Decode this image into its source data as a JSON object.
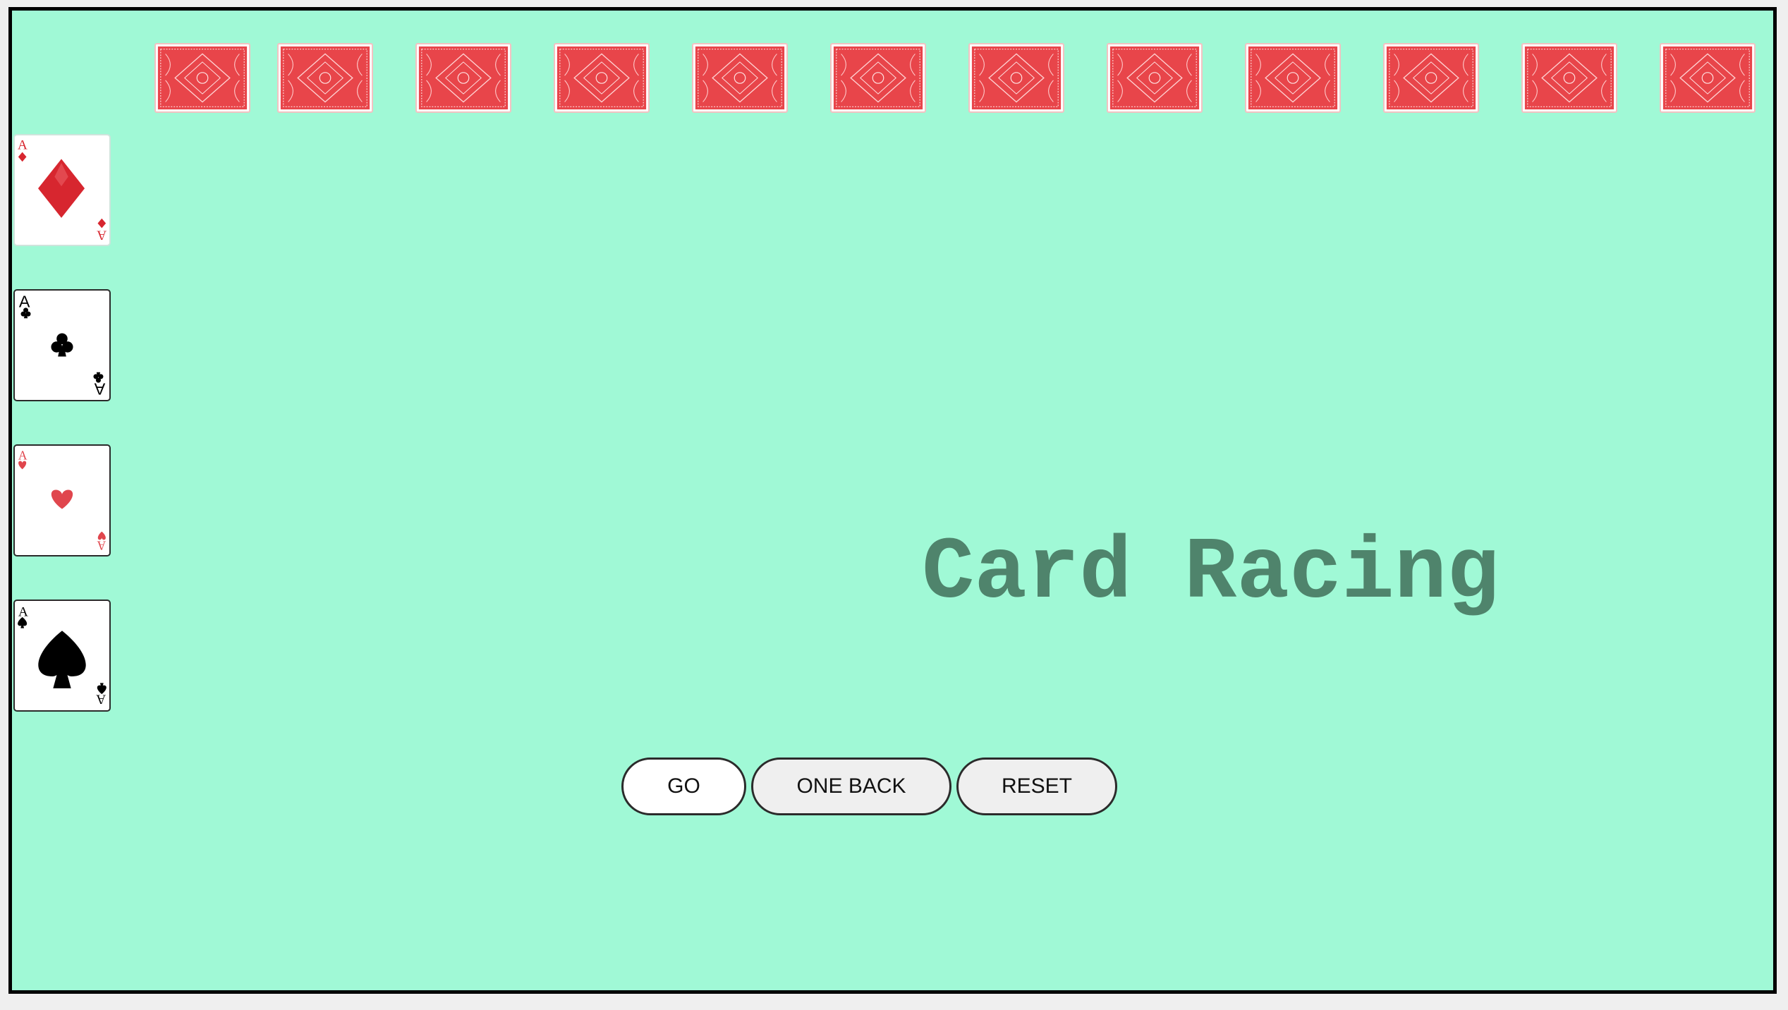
{
  "title": "Card Racing",
  "buttons": {
    "go": "GO",
    "one_back": "ONE BACK",
    "reset": "RESET"
  },
  "track_cards": [
    {
      "face": "down"
    },
    {
      "face": "down"
    },
    {
      "face": "down"
    },
    {
      "face": "down"
    },
    {
      "face": "down"
    },
    {
      "face": "down"
    },
    {
      "face": "down"
    },
    {
      "face": "down"
    },
    {
      "face": "down"
    },
    {
      "face": "down"
    },
    {
      "face": "down"
    },
    {
      "face": "down"
    }
  ],
  "racers": [
    {
      "rank": "A",
      "suit": "diamonds",
      "color": "#d7262f"
    },
    {
      "rank": "A",
      "suit": "clubs",
      "color": "#000000"
    },
    {
      "rank": "A",
      "suit": "hearts",
      "color": "#e0464d"
    },
    {
      "rank": "A",
      "suit": "spades",
      "color": "#000000"
    }
  ],
  "colors": {
    "table": "#a0f9d6",
    "title": "#4f846c",
    "card_back": "#e8454a"
  }
}
